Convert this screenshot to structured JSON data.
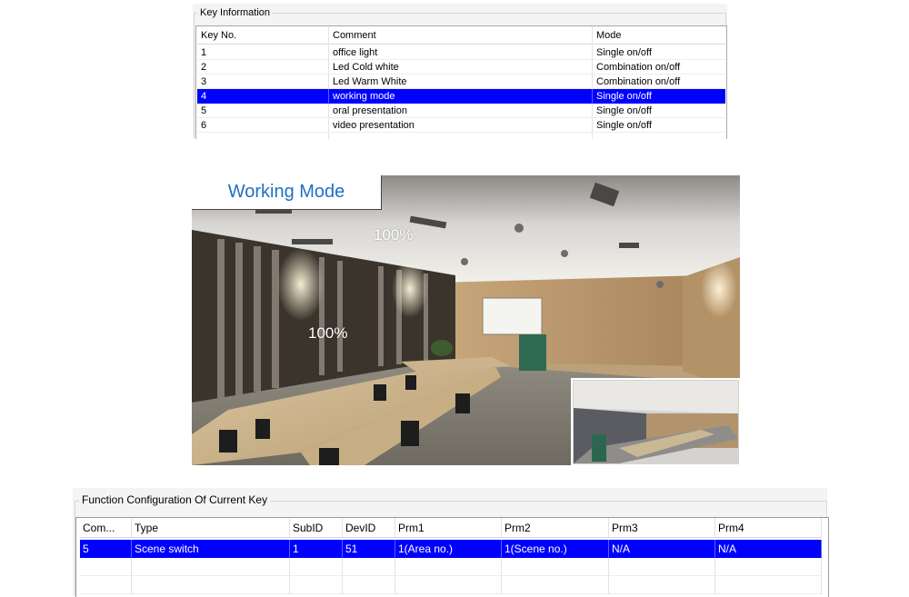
{
  "key_info": {
    "title": "Key Information",
    "columns": [
      "Key No.",
      "Comment",
      "Mode"
    ],
    "rows": [
      {
        "key": "1",
        "comment": "office light",
        "mode": "Single on/off"
      },
      {
        "key": "2",
        "comment": "Led Cold white",
        "mode": "Combination on/off"
      },
      {
        "key": "3",
        "comment": "Led Warm White",
        "mode": "Combination on/off"
      },
      {
        "key": "4",
        "comment": "working mode",
        "mode": "Single on/off"
      },
      {
        "key": "5",
        "comment": "oral presentation",
        "mode": "Single on/off"
      },
      {
        "key": "6",
        "comment": "video presentation",
        "mode": "Single on/off"
      }
    ],
    "selected_key": "4"
  },
  "scene": {
    "label": "Working Mode",
    "ceiling_level": "100%",
    "wall_level": "100%"
  },
  "function_config": {
    "title": "Function Configuration Of Current Key",
    "columns": [
      "Com...",
      "Type",
      "SubID",
      "DevID",
      "Prm1",
      "Prm2",
      "Prm3",
      "Prm4"
    ],
    "rows": [
      {
        "com": "5",
        "type": "Scene switch",
        "subid": "1",
        "devid": "51",
        "prm1": "1(Area no.)",
        "prm2": "1(Scene no.)",
        "prm3": "N/A",
        "prm4": "N/A"
      }
    ]
  },
  "colors": {
    "selection": "#0000ff",
    "mode_label_text": "#1f6fc4"
  }
}
